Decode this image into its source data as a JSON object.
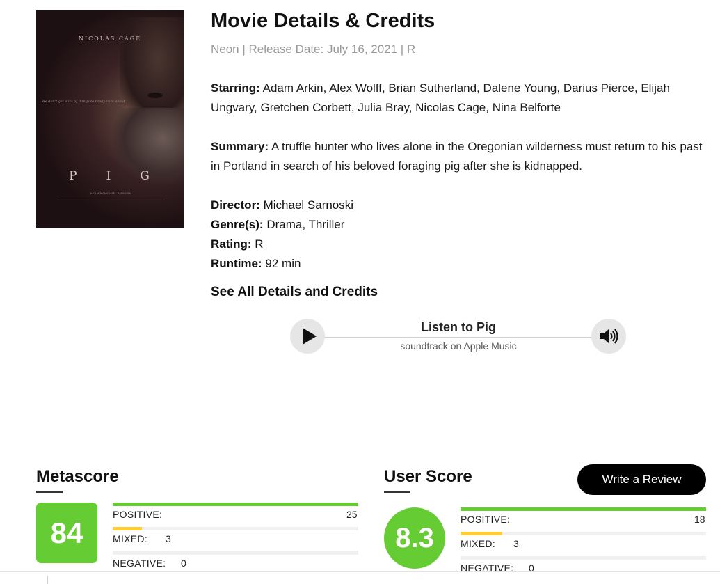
{
  "poster": {
    "actor_name": "NICOLAS CAGE",
    "tagline": "We don't get a lot of things to really care about",
    "title": "PIG",
    "credits_line": "A FILM BY MICHAEL SARNOSKI"
  },
  "header": {
    "title": "Movie Details & Credits",
    "meta": "Neon | Release Date: July 16, 2021 | R"
  },
  "details": {
    "starring_label": "Starring:",
    "starring_value": "Adam Arkin, Alex Wolff, Brian Sutherland, Dalene Young, Darius Pierce, Elijah Ungvary, Gretchen Corbett, Julia Bray, Nicolas Cage, Nina Belforte",
    "summary_label": "Summary:",
    "summary_value": "A truffle hunter who lives alone in the Oregonian wilderness must return to his past in Portland in search of his beloved foraging pig after she is kidnapped.",
    "director_label": "Director:",
    "director_value": "Michael Sarnoski",
    "genres_label": "Genre(s):",
    "genres_value": "Drama, Thriller",
    "rating_label": "Rating:",
    "rating_value": "R",
    "runtime_label": "Runtime:",
    "runtime_value": "92 min",
    "see_all": "See All Details and Credits"
  },
  "player": {
    "title": "Listen to Pig",
    "subtitle": "soundtrack on Apple Music",
    "play_icon": "play-icon",
    "volume_icon": "volume-icon"
  },
  "metascore": {
    "title": "Metascore",
    "score": "84",
    "positive_label": "POSITIVE:",
    "positive_count": "25",
    "mixed_label": "MIXED:",
    "mixed_count": "3",
    "negative_label": "NEGATIVE:",
    "negative_count": "0",
    "positive_fraction": 1.0,
    "mixed_fraction": 0.12,
    "negative_fraction": 0.0
  },
  "userscore": {
    "title": "User Score",
    "score": "8.3",
    "write_review": "Write a Review",
    "positive_label": "POSITIVE:",
    "positive_count": "18",
    "mixed_label": "MIXED:",
    "mixed_count": "3",
    "negative_label": "NEGATIVE:",
    "negative_count": "0",
    "positive_fraction": 1.0,
    "mixed_fraction": 0.17,
    "negative_fraction": 0.0
  },
  "colors": {
    "positive": "#66cc33",
    "mixed": "#ffcc33",
    "negative": "#ff0000",
    "track": "#f0f0f0"
  }
}
